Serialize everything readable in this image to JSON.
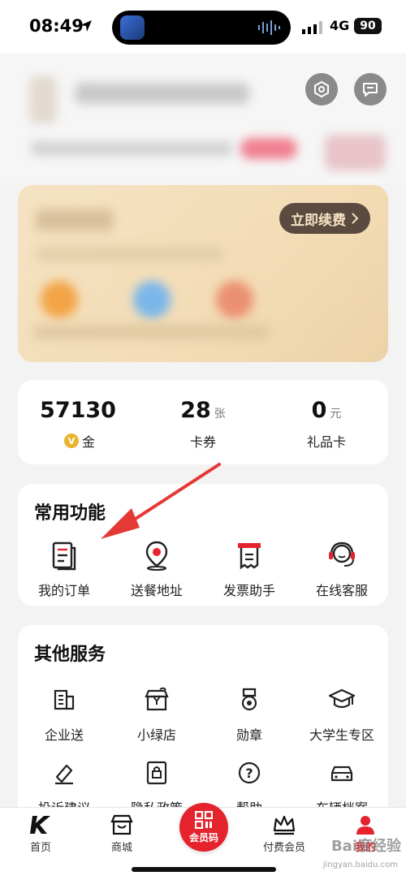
{
  "status_bar": {
    "time": "08:49",
    "network": "4G",
    "battery": "90"
  },
  "vip": {
    "renew_label": "立即续费"
  },
  "stats": [
    {
      "value": "57130",
      "unit": "",
      "label": "金"
    },
    {
      "value": "28",
      "unit": "张",
      "label": "卡券"
    },
    {
      "value": "0",
      "unit": "元",
      "label": "礼品卡"
    }
  ],
  "common": {
    "title": "常用功能",
    "items": [
      {
        "label": "我的订单",
        "icon": "order-icon"
      },
      {
        "label": "送餐地址",
        "icon": "location-pin-icon"
      },
      {
        "label": "发票助手",
        "icon": "invoice-icon"
      },
      {
        "label": "在线客服",
        "icon": "headset-icon"
      }
    ]
  },
  "other": {
    "title": "其他服务",
    "items": [
      {
        "label": "企业送",
        "icon": "building-icon"
      },
      {
        "label": "小绿店",
        "icon": "green-store-icon"
      },
      {
        "label": "勋章",
        "icon": "medal-icon"
      },
      {
        "label": "大学生专区",
        "icon": "graduation-cap-icon"
      },
      {
        "label": "投诉建议",
        "icon": "feedback-icon"
      },
      {
        "label": "隐私政策",
        "icon": "privacy-icon"
      },
      {
        "label": "帮助",
        "icon": "help-icon"
      },
      {
        "label": "车辆档案",
        "icon": "car-icon"
      }
    ]
  },
  "tabbar": {
    "items": [
      {
        "label": "首页",
        "icon": "kfc-logo-icon"
      },
      {
        "label": "商城",
        "icon": "store-icon"
      },
      {
        "label": "会员码",
        "icon": "qr-code-icon"
      },
      {
        "label": "付费会员",
        "icon": "crown-icon"
      },
      {
        "label": "我的",
        "icon": "profile-icon"
      }
    ]
  },
  "colors": {
    "accent": "#e4232d",
    "vip_bg": "#f3dcb5",
    "renew_bg": "#5a4a3f"
  },
  "watermark": {
    "text": "Bai度经验",
    "sub": "jingyan.baidu.com"
  }
}
